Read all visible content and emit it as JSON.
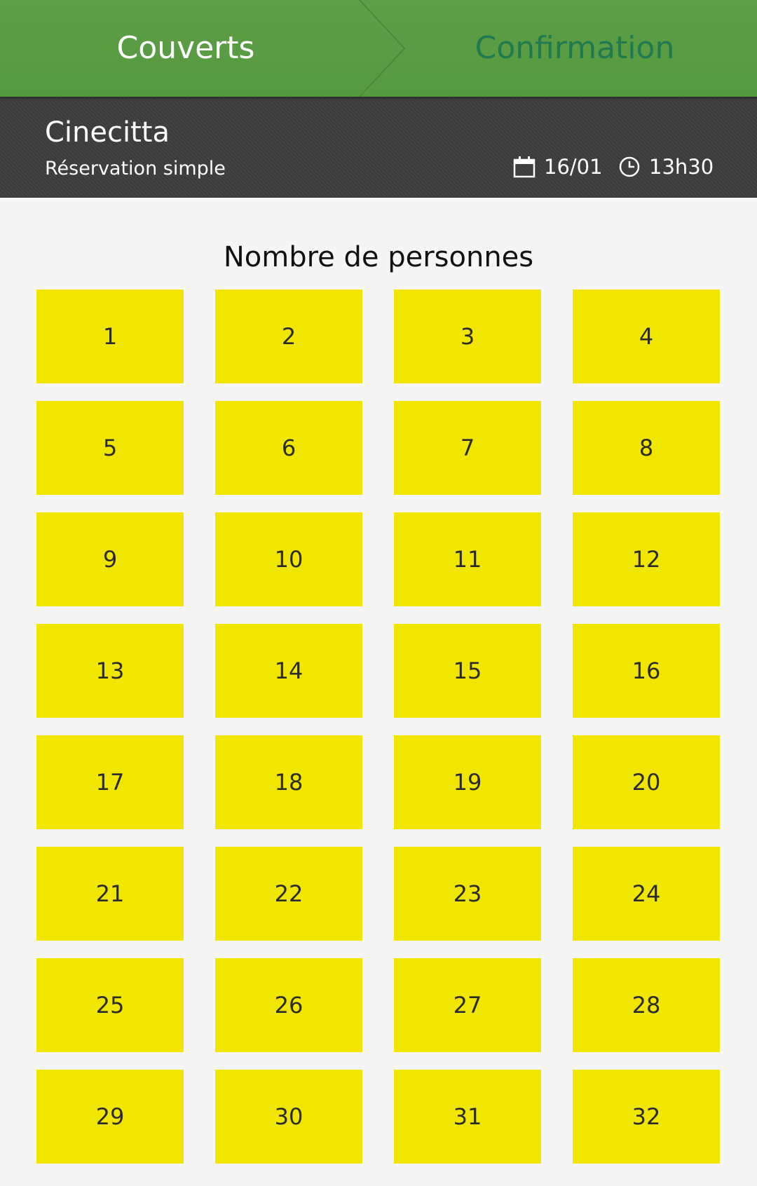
{
  "steps": {
    "active": "Couverts",
    "next": "Confirmation"
  },
  "restaurant": {
    "name": "Cinecitta",
    "type": "Réservation simple",
    "date": "16/01",
    "time": "13h30"
  },
  "section_title": "Nombre de personnes",
  "counts": [
    "1",
    "2",
    "3",
    "4",
    "5",
    "6",
    "7",
    "8",
    "9",
    "10",
    "11",
    "12",
    "13",
    "14",
    "15",
    "16",
    "17",
    "18",
    "19",
    "20",
    "21",
    "22",
    "23",
    "24",
    "25",
    "26",
    "27",
    "28",
    "29",
    "30",
    "31",
    "32"
  ],
  "colors": {
    "header_green": "#5e9e46",
    "next_step_text": "#1f7a52",
    "info_bar": "#3d3d3d",
    "option_yellow": "#f0e600",
    "background": "#f5f5f5"
  },
  "icons": {
    "date": "calendar-icon",
    "time": "clock-icon"
  }
}
